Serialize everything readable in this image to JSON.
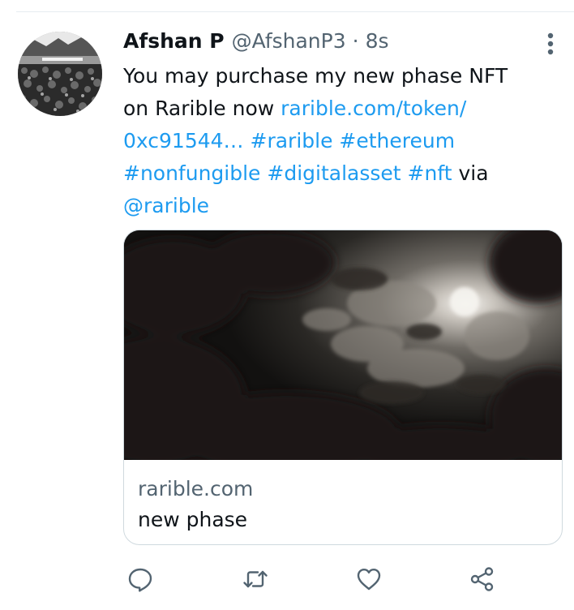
{
  "tweet": {
    "display_name": "Afshan P",
    "handle": "@AfshanP3",
    "separator": "·",
    "timestamp": "8s",
    "text": {
      "line1": "You may purchase my new phase NFT",
      "line2_prefix": "on Rarible now ",
      "line2_link": "rarible.com/token/",
      "line3_link": "0xc91544…",
      "line3_tag1": "#rarible",
      "line3_tag2": "#ethereum",
      "line4_tag1": "#nonfungible",
      "line4_tag2": "#digitalasset",
      "line4_tag3": "#nft",
      "line4_suffix": " via",
      "line5_mention": "@rarible"
    }
  },
  "card": {
    "domain": "rarible.com",
    "title": "new phase"
  },
  "icons": {
    "more": "more-vertical-icon",
    "reply": "reply-icon",
    "retweet": "retweet-icon",
    "like": "like-icon",
    "share": "share-icon"
  },
  "colors": {
    "link": "#1d9bf0",
    "secondary_text": "#536471",
    "primary_text": "#0f1419",
    "border": "#cfd9de"
  }
}
